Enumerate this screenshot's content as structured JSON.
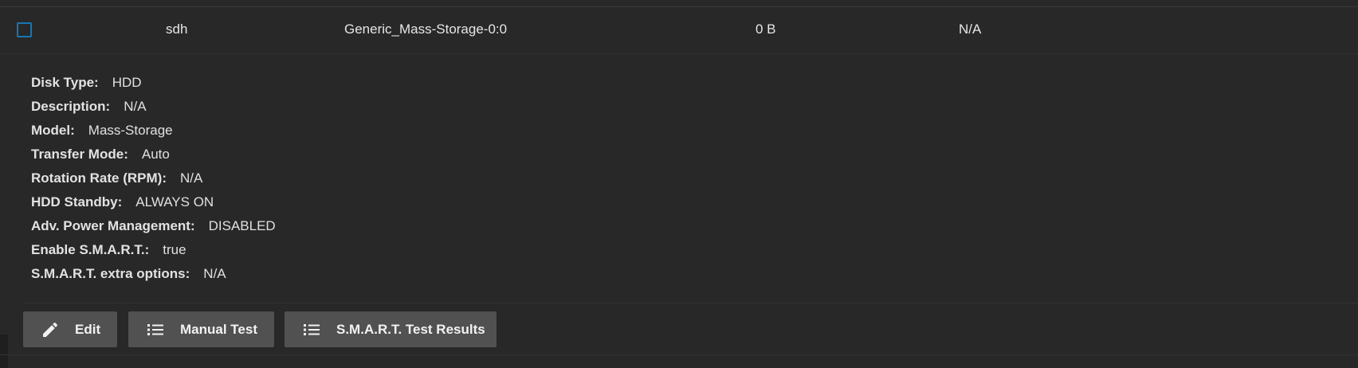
{
  "row": {
    "device": "sdh",
    "serial": "Generic_Mass-Storage-0:0",
    "size": "0 B",
    "pool": "N/A"
  },
  "details": [
    {
      "label": "Disk Type:",
      "value": "HDD"
    },
    {
      "label": "Description:",
      "value": "N/A"
    },
    {
      "label": "Model:",
      "value": "Mass-Storage"
    },
    {
      "label": "Transfer Mode:",
      "value": "Auto"
    },
    {
      "label": "Rotation Rate (RPM):",
      "value": "N/A"
    },
    {
      "label": "HDD Standby:",
      "value": "ALWAYS ON"
    },
    {
      "label": "Adv. Power Management:",
      "value": "DISABLED"
    },
    {
      "label": "Enable S.M.A.R.T.:",
      "value": "true"
    },
    {
      "label": "S.M.A.R.T. extra options:",
      "value": "N/A"
    }
  ],
  "actions": {
    "edit": {
      "label": "Edit",
      "icon": "pencil-icon"
    },
    "manual_test": {
      "label": "Manual Test",
      "icon": "list-icon"
    },
    "smart_results": {
      "label": "S.M.A.R.T. Test Results",
      "icon": "list-icon"
    }
  },
  "colors": {
    "background": "#282828",
    "button": "#515151",
    "checkbox_border": "#1677b3"
  }
}
